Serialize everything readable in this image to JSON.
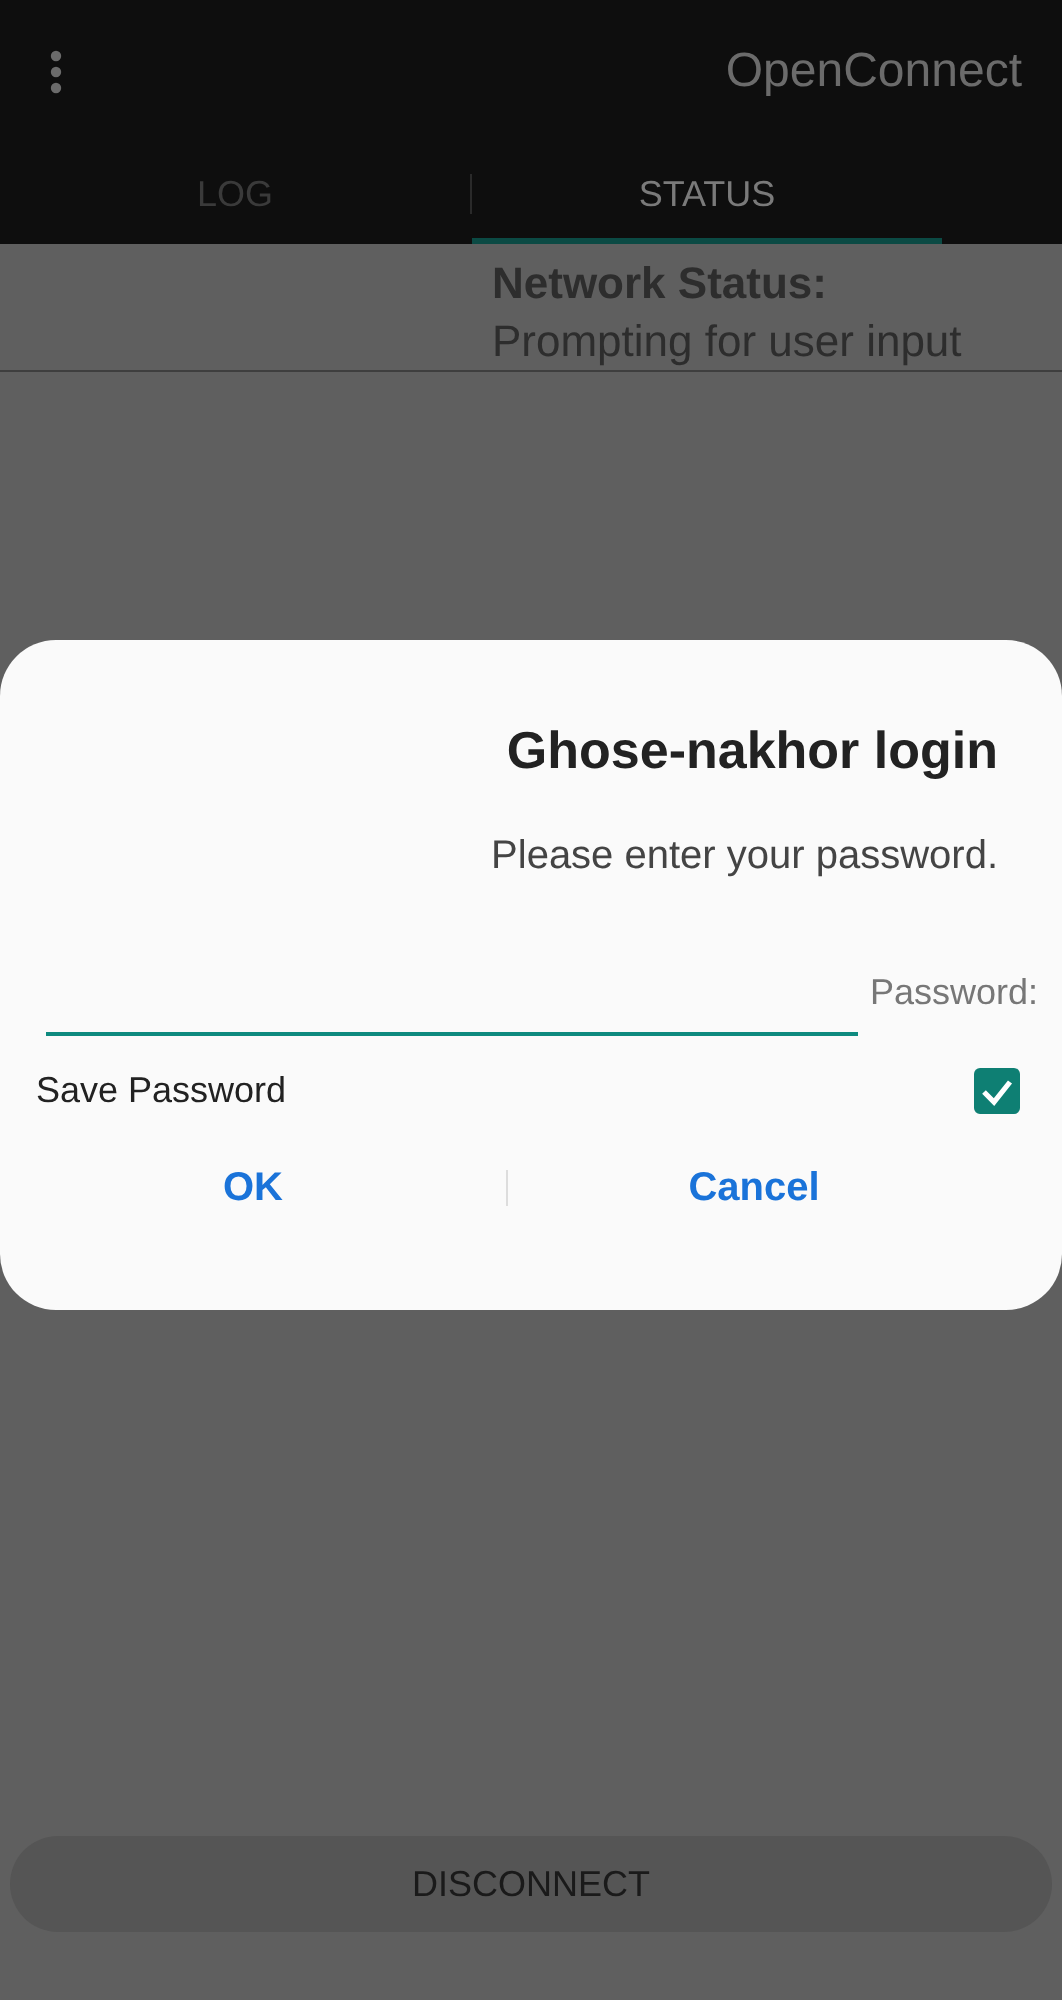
{
  "app_bar": {
    "title": "OpenConnect"
  },
  "tabs": [
    {
      "label": "LOG",
      "selected": false
    },
    {
      "label": "STATUS",
      "selected": true
    }
  ],
  "status": {
    "heading": "Network Status:",
    "value": "Prompting for user input"
  },
  "dialog": {
    "title": "Ghose-nakhor login",
    "message": "Please enter your password.",
    "field": {
      "label": "Password:"
    },
    "checkbox": {
      "label": "Save Password",
      "checked": true
    },
    "buttons": [
      "OK",
      "Cancel"
    ]
  },
  "disconnect_button": "DISCONNECT"
}
